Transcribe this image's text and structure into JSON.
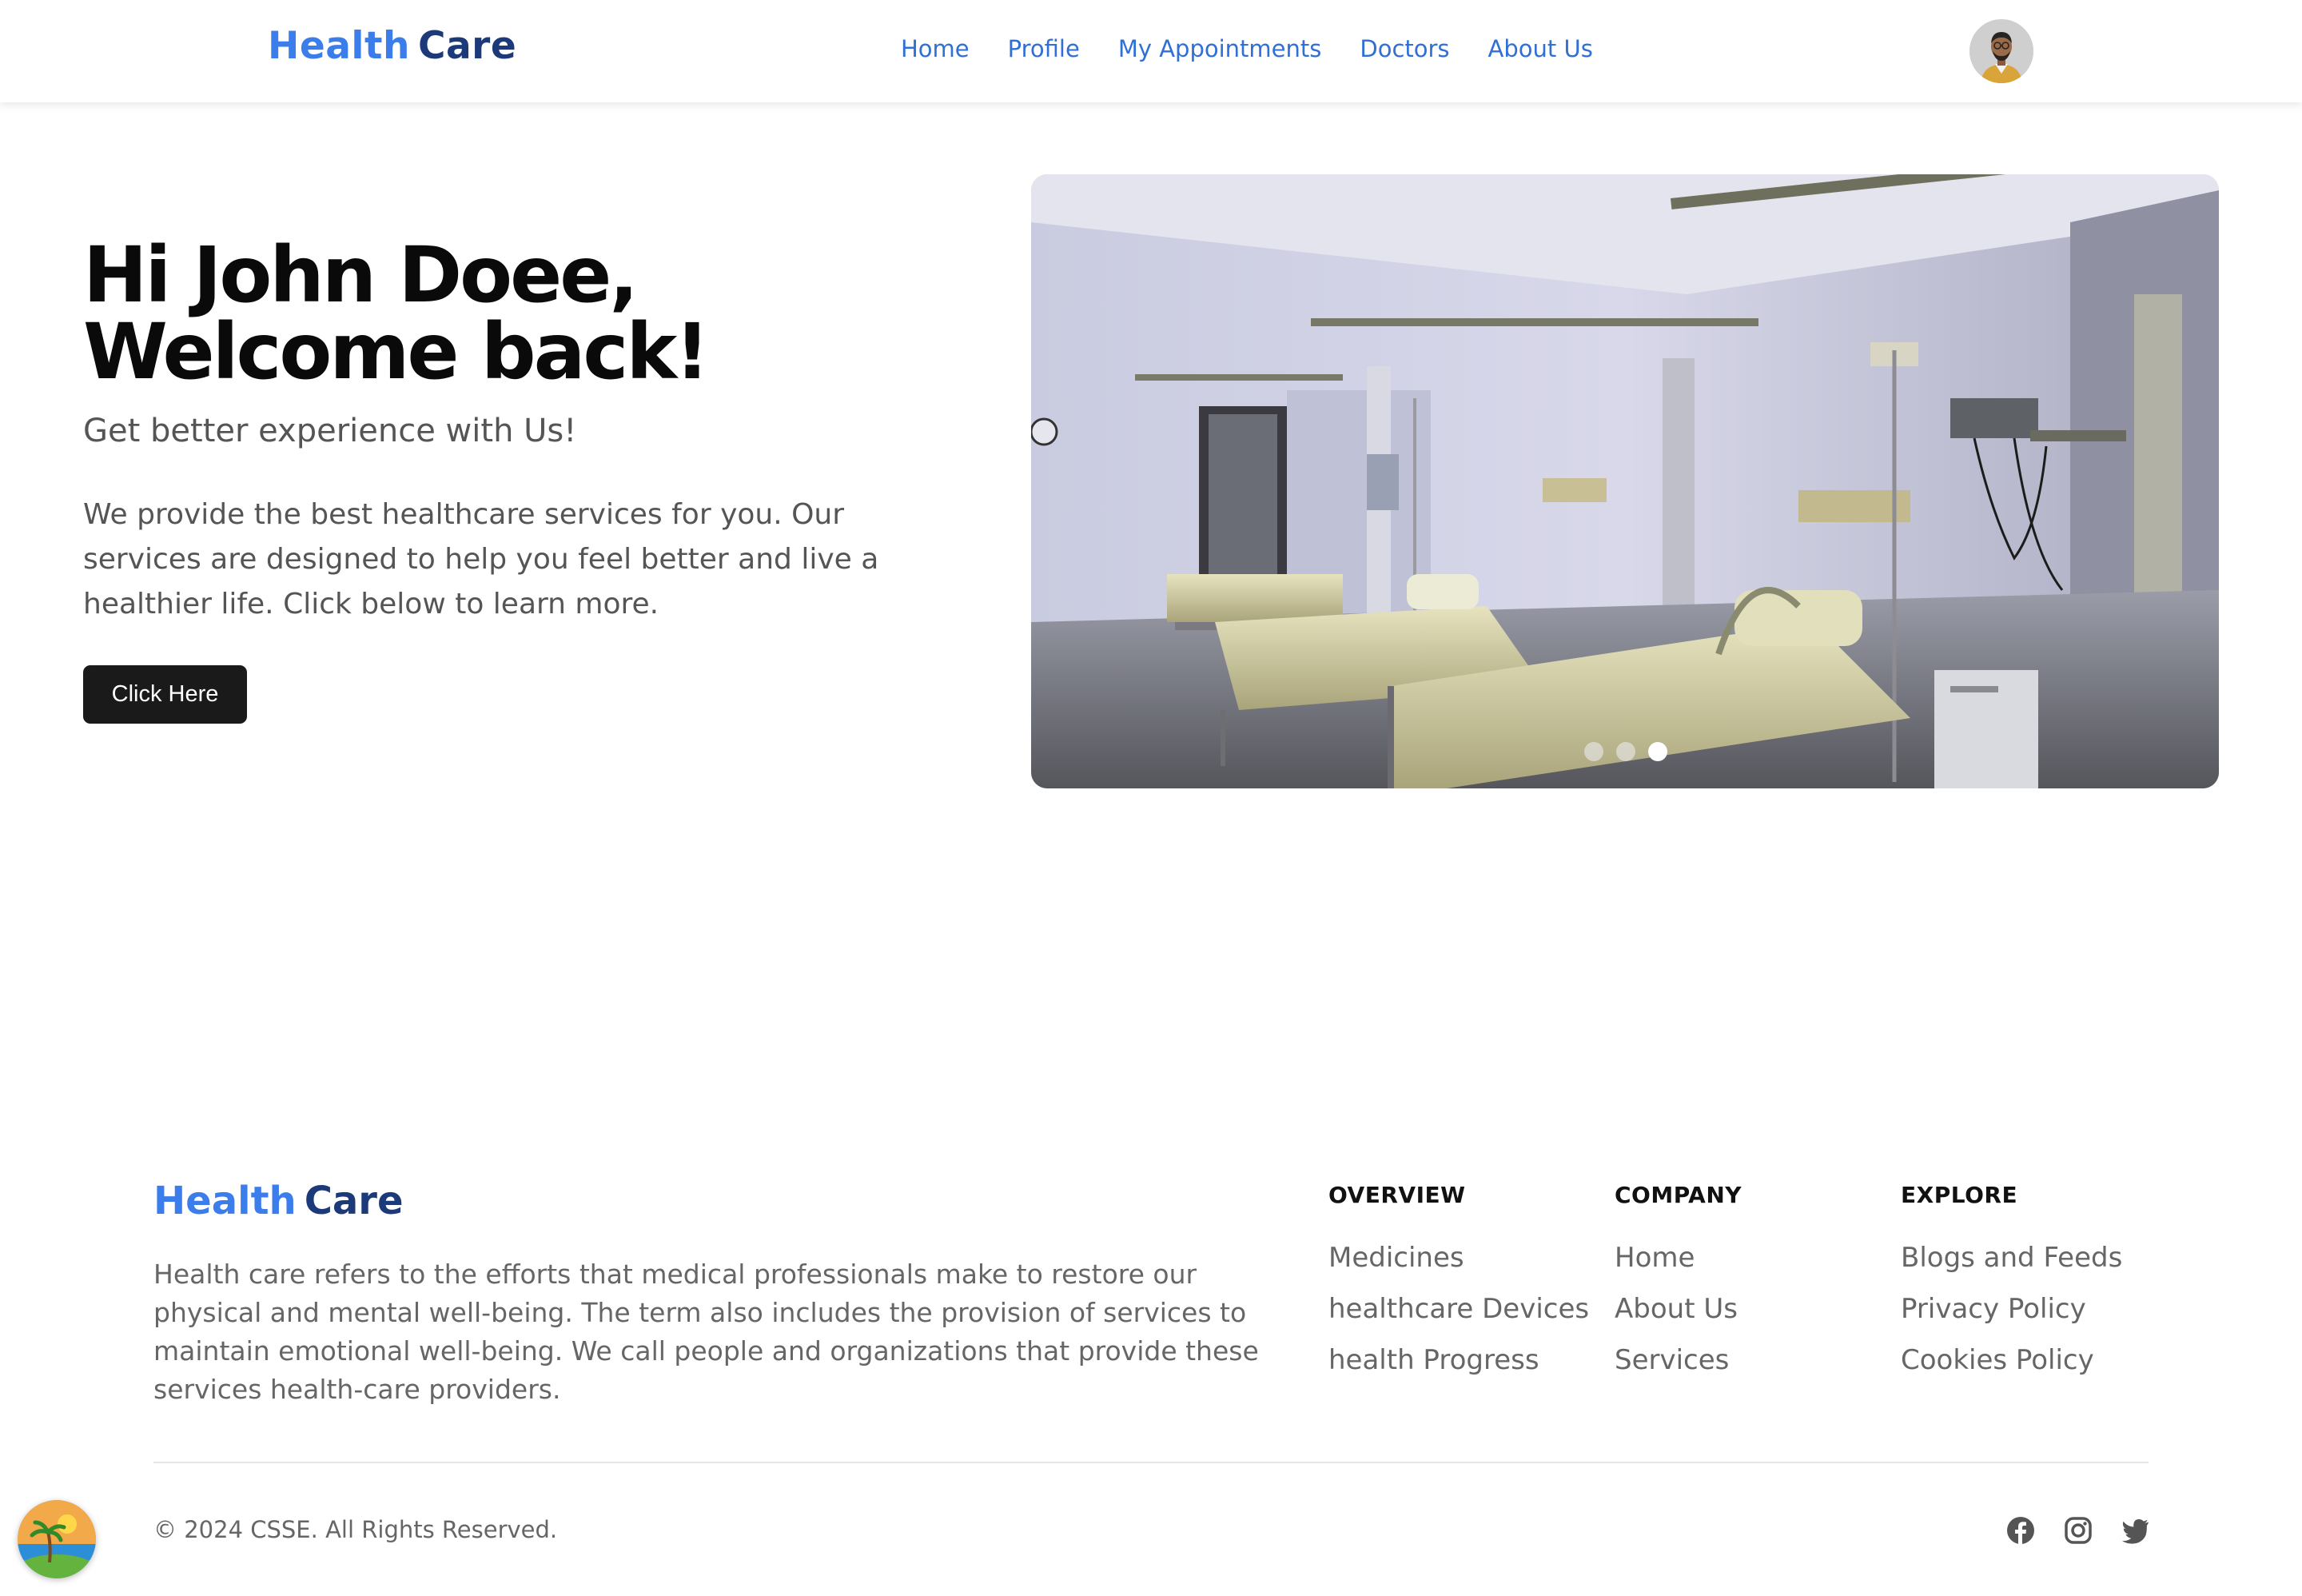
{
  "navbar": {
    "brand_part1": "Health",
    "brand_part2": "Care",
    "links": [
      "Home",
      "Profile",
      "My Appointments",
      "Doctors",
      "About Us"
    ]
  },
  "hero": {
    "title_line1": "Hi John Doee,",
    "title_line2": "Welcome back!",
    "subtitle": "Get better experience with Us!",
    "description": "We provide the best healthcare services for you. Our services are designed to help you feel better and live a healthier life. Click below to learn more.",
    "cta_label": "Click Here",
    "carousel": {
      "slide_count": 3,
      "active_slide": 3
    }
  },
  "footer": {
    "brand_part1": "Health",
    "brand_part2": "Care",
    "description": "Health care refers to the efforts that medical professionals make to restore our physical and mental well-being. The term also includes the provision of services to maintain emotional well-being. We call people and organizations that provide these services health-care providers.",
    "columns": [
      {
        "heading": "OVERVIEW",
        "items": [
          "Medicines",
          "healthcare Devices",
          "health Progress"
        ]
      },
      {
        "heading": "COMPANY",
        "items": [
          "Home",
          "About Us",
          "Services"
        ]
      },
      {
        "heading": "EXPLORE",
        "items": [
          "Blogs and Feeds",
          "Privacy Policy",
          "Cookies Policy"
        ]
      }
    ],
    "copyright": "© 2024 CSSE. All Rights Reserved.",
    "social_icons": [
      "facebook-icon",
      "instagram-icon",
      "twitter-icon"
    ]
  },
  "colors": {
    "brand_blue": "#3b7dea",
    "brand_navy": "#1c3a7a",
    "nav_link": "#2f6fd6",
    "button_dark": "#1a1a1a"
  }
}
